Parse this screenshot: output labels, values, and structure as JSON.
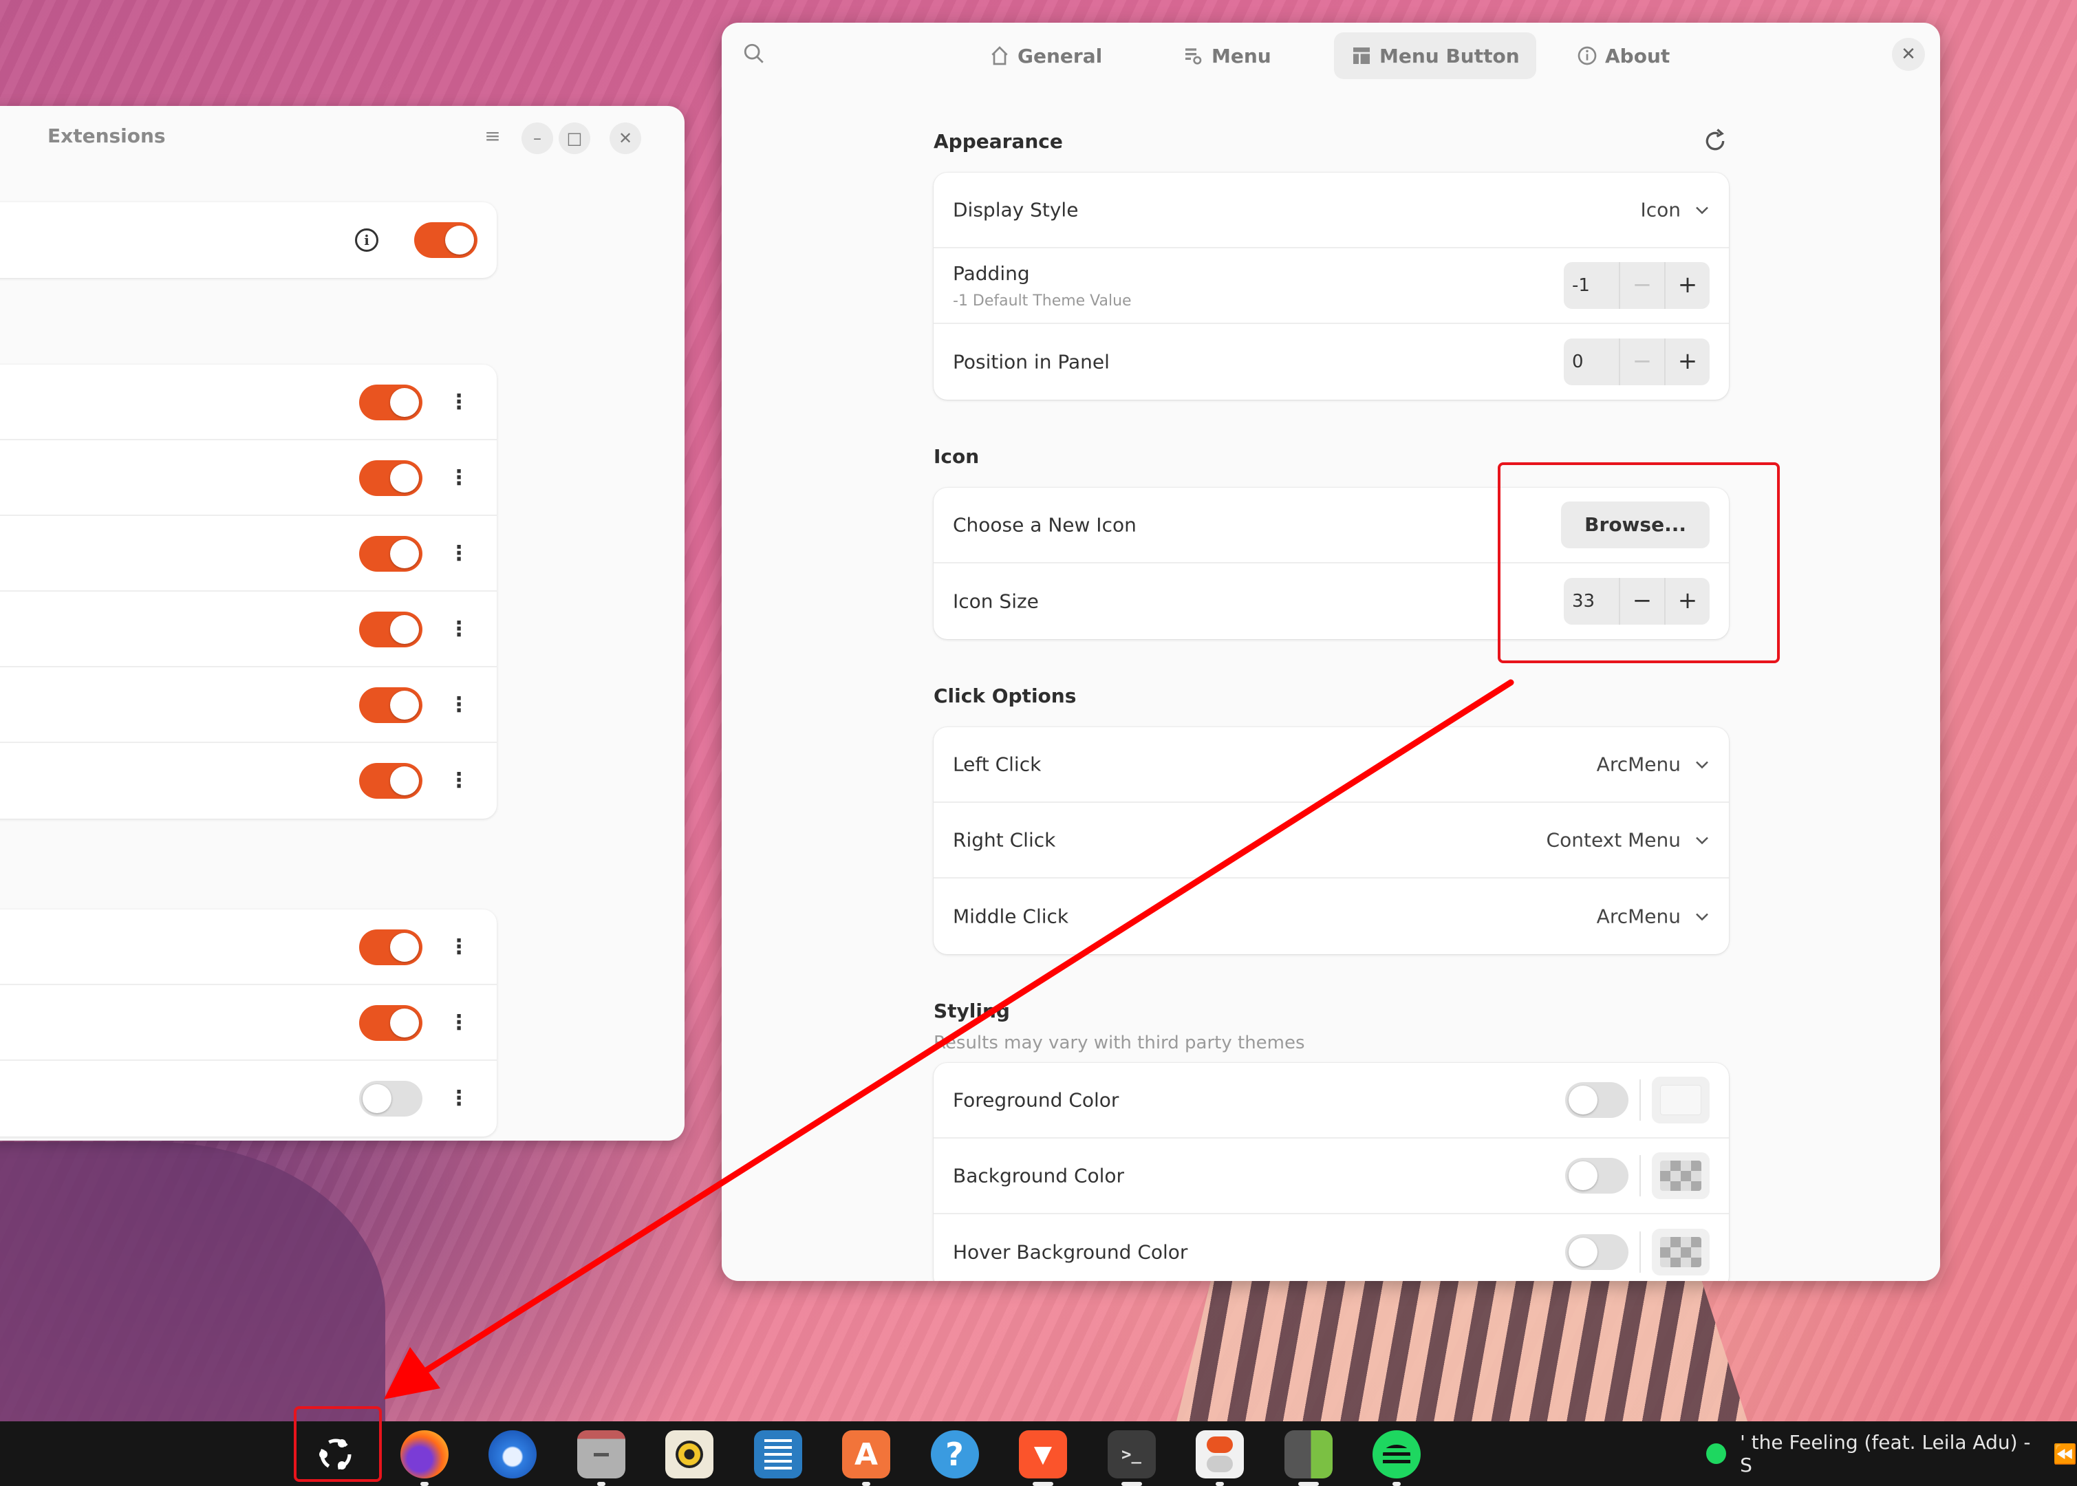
{
  "extensions_window": {
    "title": "Extensions",
    "top_card": {
      "info_icon": "info-icon",
      "enabled": true
    },
    "group1": [
      {
        "enabled": true
      },
      {
        "enabled": true
      },
      {
        "enabled": true
      },
      {
        "enabled": true
      },
      {
        "enabled": true
      },
      {
        "enabled": true
      }
    ],
    "group2": [
      {
        "enabled": true
      },
      {
        "enabled": true
      },
      {
        "enabled": false
      }
    ],
    "controls": {
      "menu": "≡",
      "minimize": "–",
      "maximize": "□",
      "close": "✕"
    }
  },
  "settings_window": {
    "tabs": [
      {
        "label": "General",
        "icon": "home-icon",
        "active": false
      },
      {
        "label": "Menu",
        "icon": "menu-settings-icon",
        "active": false
      },
      {
        "label": "Menu Button",
        "icon": "menu-button-icon",
        "active": true
      },
      {
        "label": "About",
        "icon": "info-icon",
        "active": false
      }
    ],
    "close": "✕",
    "appearance": {
      "title": "Appearance",
      "display_style": {
        "label": "Display Style",
        "value": "Icon"
      },
      "padding": {
        "label": "Padding",
        "sublabel": "-1 Default Theme Value",
        "value": "-1",
        "minus": "−",
        "plus": "+"
      },
      "position": {
        "label": "Position in Panel",
        "value": "0",
        "minus": "−",
        "plus": "+"
      }
    },
    "icon": {
      "title": "Icon",
      "choose": {
        "label": "Choose a New Icon",
        "button": "Browse..."
      },
      "size": {
        "label": "Icon Size",
        "value": "33",
        "minus": "−",
        "plus": "+"
      }
    },
    "click_options": {
      "title": "Click Options",
      "left": {
        "label": "Left Click",
        "value": "ArcMenu"
      },
      "right": {
        "label": "Right Click",
        "value": "Context Menu"
      },
      "middle": {
        "label": "Middle Click",
        "value": "ArcMenu"
      }
    },
    "styling": {
      "title": "Styling",
      "subtitle": "Results may vary with third party themes",
      "rows": [
        {
          "label": "Foreground Color",
          "enabled": false,
          "swatch": "white"
        },
        {
          "label": "Background Color",
          "enabled": false,
          "swatch": "transparent"
        },
        {
          "label": "Hover Background Color",
          "enabled": false,
          "swatch": "transparent"
        }
      ]
    }
  },
  "taskbar": {
    "apps": [
      {
        "name": "ubuntu-menu",
        "icon": "ubuntu-logo-icon",
        "running": 0,
        "highlighted": true
      },
      {
        "name": "firefox",
        "icon": "firefox-icon",
        "running": 1
      },
      {
        "name": "thunderbird",
        "icon": "thunderbird-icon",
        "running": 0
      },
      {
        "name": "files",
        "icon": "files-icon",
        "running": 1
      },
      {
        "name": "rhythmbox",
        "icon": "rhythmbox-icon",
        "running": 0
      },
      {
        "name": "libreoffice-writer",
        "icon": "writer-icon",
        "running": 0
      },
      {
        "name": "app-center",
        "icon": "app-center-icon",
        "running": 1
      },
      {
        "name": "help",
        "icon": "help-icon",
        "running": 0
      },
      {
        "name": "brave",
        "icon": "brave-icon",
        "running": 2
      },
      {
        "name": "terminal",
        "icon": "terminal-icon",
        "running": 2
      },
      {
        "name": "settings",
        "icon": "toggle-settings-icon",
        "running": 1
      },
      {
        "name": "extensions",
        "icon": "extensions-icon",
        "running": 2
      },
      {
        "name": "spotify",
        "icon": "spotify-icon",
        "running": 1
      }
    ],
    "media": {
      "text": "' the Feeling (feat. Leila Adu) - S",
      "prev": "⏪"
    }
  },
  "colors": {
    "accent": "#e95420",
    "annotation": "#e8141c",
    "taskbar": "#161616",
    "window_bg": "#fafafa"
  }
}
